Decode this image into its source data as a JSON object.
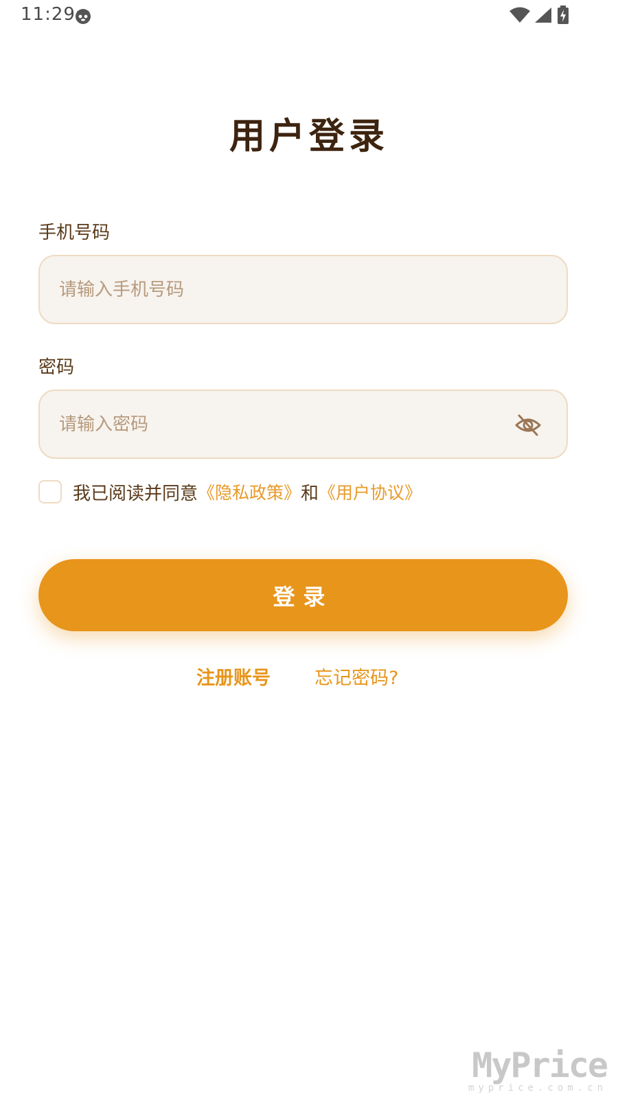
{
  "status_bar": {
    "time": "11:29",
    "app_icon": "cat-face-icon",
    "wifi_icon": "wifi-icon",
    "signal_icon": "cell-signal-icon",
    "battery_icon": "battery-charging-icon"
  },
  "title": "用户登录",
  "phone": {
    "label": "手机号码",
    "placeholder": "请输入手机号码",
    "value": ""
  },
  "password": {
    "label": "密码",
    "placeholder": "请输入密码",
    "value": "",
    "toggle_icon": "eye-off-icon"
  },
  "agreement": {
    "checked": false,
    "text_prefix": "我已阅读并同意",
    "privacy_link": "《隐私政策》",
    "connector": "和",
    "terms_link": "《用户协议》"
  },
  "login_button": "登录",
  "register_link": "注册账号",
  "forgot_link": "忘记密码?",
  "watermark": {
    "logo": "MyPrice",
    "url": "myprice.com.cn"
  },
  "colors": {
    "accent": "#e8951b",
    "title": "#3d2410",
    "label": "#5a3a1a",
    "input_bg": "#f7f3ee",
    "input_border": "#eedbc3",
    "placeholder": "#b69a7d"
  }
}
